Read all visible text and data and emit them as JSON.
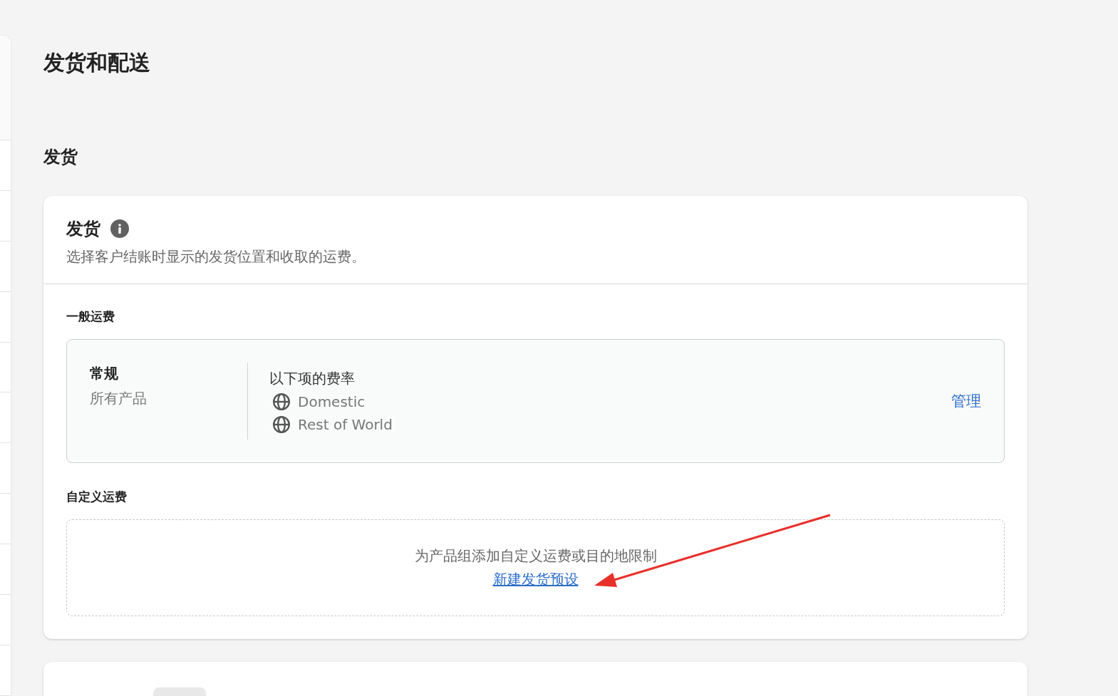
{
  "page": {
    "title": "发货和配送"
  },
  "section": {
    "heading": "发货"
  },
  "card": {
    "title": "发货",
    "description": "选择客户结账时显示的发货位置和收取的运费。",
    "general": {
      "label": "一般运费",
      "profile": {
        "name": "常规",
        "scope": "所有产品",
        "rates_label": "以下项的费率",
        "zones": [
          "Domestic",
          "Rest of World"
        ],
        "action": "管理"
      }
    },
    "custom": {
      "label": "自定义运费",
      "empty_text": "为产品组添加自定义运费或目的地限制",
      "link": "新建发货预设"
    }
  }
}
